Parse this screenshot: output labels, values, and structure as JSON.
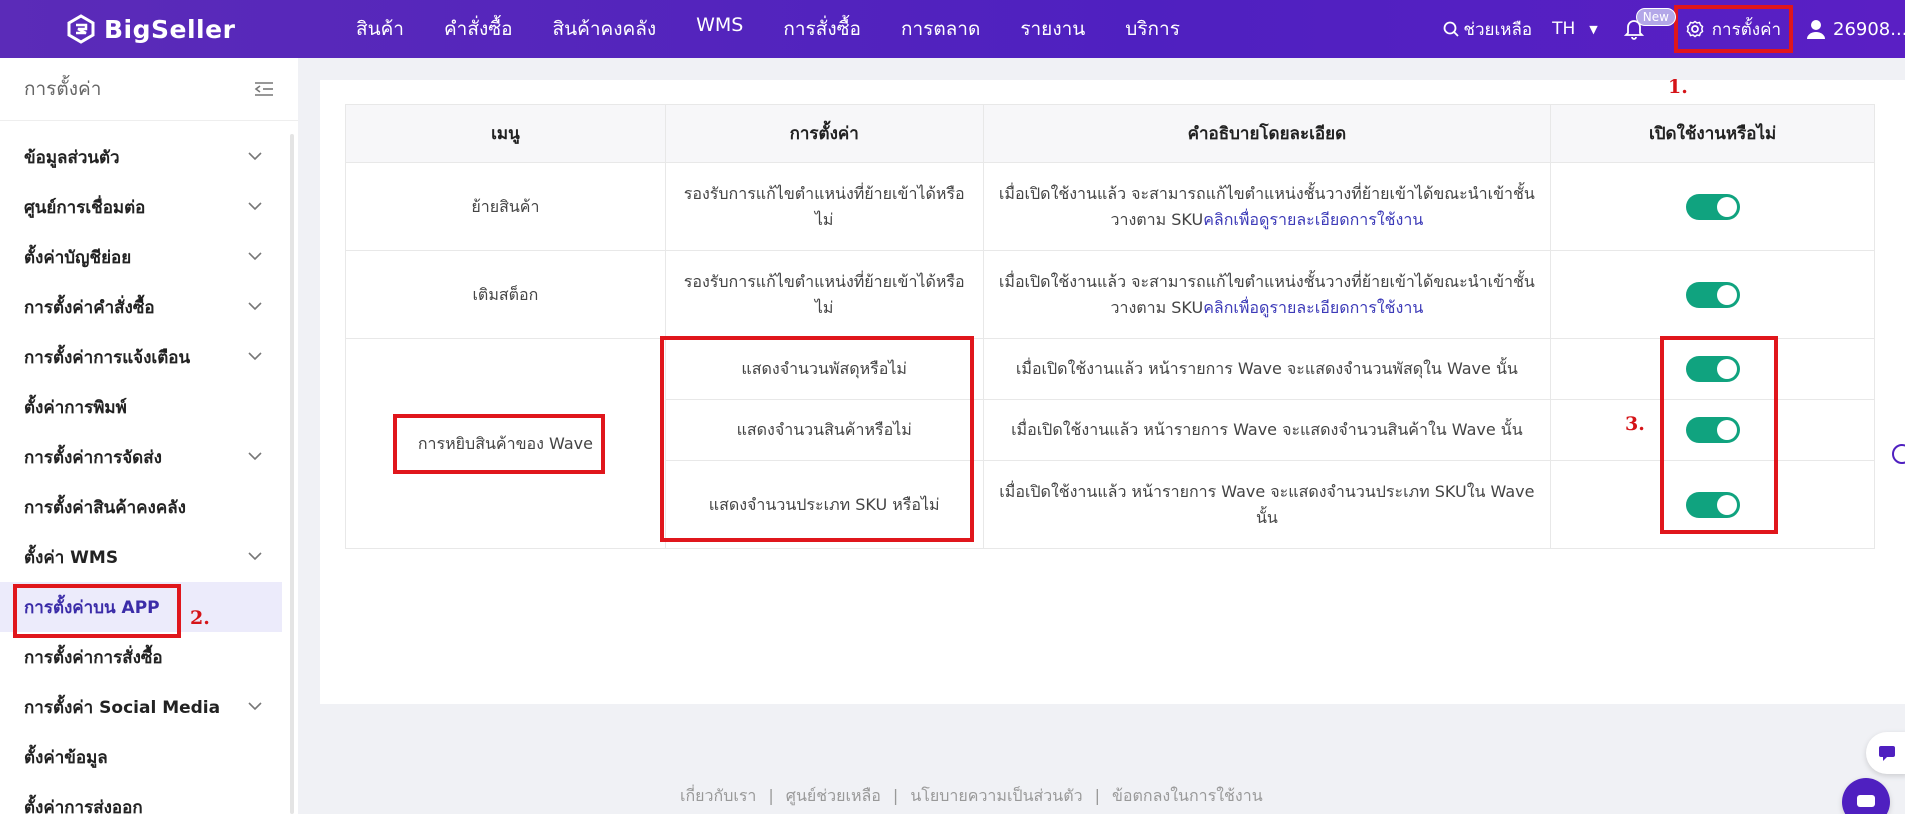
{
  "brand": {
    "name": "BigSeller"
  },
  "nav": {
    "items": [
      "สินค้า",
      "คำสั่งซื้อ",
      "สินค้าคงคลัง",
      "WMS",
      "การสั่งซื้อ",
      "การตลาด",
      "รายงาน",
      "บริการ"
    ]
  },
  "header": {
    "help": "ช่วยเหลือ",
    "lang": "TH",
    "new_badge": "New",
    "settings": "การตั้งค่า",
    "user": "26908..."
  },
  "sidebar": {
    "title": "การตั้งค่า",
    "items": [
      {
        "label": "ข้อมูลส่วนตัว",
        "chevron": true
      },
      {
        "label": "ศูนย์การเชื่อมต่อ",
        "chevron": true
      },
      {
        "label": "ตั้งค่าบัญชีย่อย",
        "chevron": true
      },
      {
        "label": "การตั้งค่าคำสั่งซื้อ",
        "chevron": true
      },
      {
        "label": "การตั้งค่าการแจ้งเตือน",
        "chevron": true
      },
      {
        "label": "ตั้งค่าการพิมพ์",
        "chevron": false
      },
      {
        "label": "การตั้งค่าการจัดส่ง",
        "chevron": true
      },
      {
        "label": "การตั้งค่าสินค้าคงคลัง",
        "chevron": false
      },
      {
        "label": "ตั้งค่า WMS",
        "chevron": true
      },
      {
        "label": "การตั้งค่าบน APP",
        "chevron": false,
        "active": true
      },
      {
        "label": "การตั้งค่าการสั่งซื้อ",
        "chevron": false
      },
      {
        "label": "การตั้งค่า Social Media",
        "chevron": true
      },
      {
        "label": "ตั้งค่าข้อมูล",
        "chevron": false
      },
      {
        "label": "ตั้งค่าการส่งออก",
        "chevron": false
      }
    ]
  },
  "table": {
    "headers": [
      "เมนู",
      "การตั้งค่า",
      "คำอธิบายโดยละเอียด",
      "เปิดใช้งานหรือไม่"
    ],
    "rows": [
      {
        "menu": "ย้ายสินค้า",
        "setting": "รองรับการแก้ไขตำแหน่งที่ย้ายเข้าได้หรือไม่",
        "desc": "เมื่อเปิดใช้งานแล้ว จะสามารถแก้ไขตำแหน่งชั้นวางที่ย้ายเข้าได้ขณะนำเข้าชั้นวางตาม SKU",
        "link": "คลิกเพื่อดูรายละเอียดการใช้งาน",
        "enabled": true
      },
      {
        "menu": "เติมสต็อก",
        "setting": "รองรับการแก้ไขตำแหน่งที่ย้ายเข้าได้หรือไม่",
        "desc": "เมื่อเปิดใช้งานแล้ว จะสามารถแก้ไขตำแหน่งชั้นวางที่ย้ายเข้าได้ขณะนำเข้าชั้นวางตาม SKU",
        "link": "คลิกเพื่อดูรายละเอียดการใช้งาน",
        "enabled": true
      }
    ],
    "wave_menu": "การหยิบสินค้าของ Wave",
    "wave_rows": [
      {
        "setting": "แสดงจำนวนพัสดุหรือไม่",
        "desc": "เมื่อเปิดใช้งานแล้ว หน้ารายการ Wave จะแสดงจำนวนพัสดุใน Wave นั้น",
        "enabled": true
      },
      {
        "setting": "แสดงจำนวนสินค้าหรือไม่",
        "desc": "เมื่อเปิดใช้งานแล้ว หน้ารายการ Wave จะแสดงจำนวนสินค้าใน Wave นั้น",
        "enabled": true
      },
      {
        "setting": "แสดงจำนวนประเภท SKU หรือไม่",
        "desc": "เมื่อเปิดใช้งานแล้ว หน้ารายการ Wave จะแสดงจำนวนประเภท SKUใน Wave นั้น",
        "enabled": true
      }
    ]
  },
  "annotations": [
    "1.",
    "2.",
    "3."
  ],
  "footer": {
    "links": [
      "เกี่ยวกับเรา",
      "ศูนย์ช่วยเหลือ",
      "นโยบายความเป็นส่วนตัว",
      "ข้อตกลงในการใช้งาน"
    ]
  },
  "colors": {
    "nav_bg": "#5222bf",
    "toggle_on": "#10a37f",
    "annotation": "#e0161c",
    "link": "#3c3ab8"
  }
}
